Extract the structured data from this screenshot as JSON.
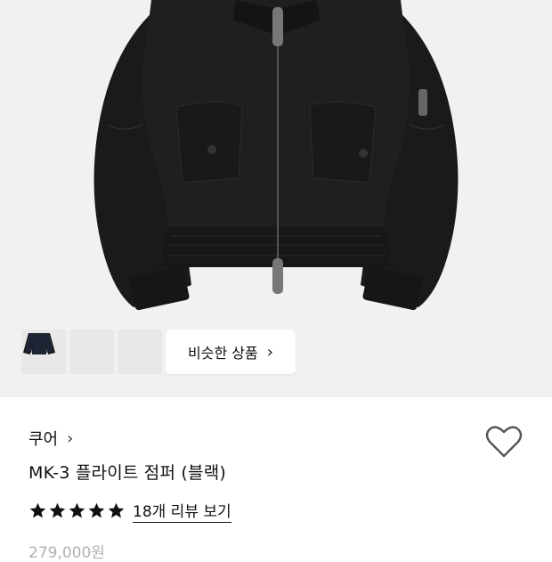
{
  "product": {
    "brand": "쿠어",
    "title": "MK-3 플라이트 점퍼 (블랙)",
    "rating_stars": 5,
    "review_link": "18개 리뷰 보기",
    "original_price": "279,000원"
  },
  "gallery": {
    "thumbnails": [
      "black-jacket-front",
      "black-jacket-alt",
      "navy-jacket"
    ],
    "similar_button": "비슷한 상품"
  },
  "icons": {
    "brand_chevron": "chevron-right-icon",
    "similar_chevron": "chevron-right-icon",
    "wishlist": "heart-outline-icon",
    "rating": "star-icon"
  },
  "colors": {
    "hero_bg": "#f1f1f1",
    "jacket": "#1b1b1b",
    "price_muted": "#b0b0b0"
  }
}
